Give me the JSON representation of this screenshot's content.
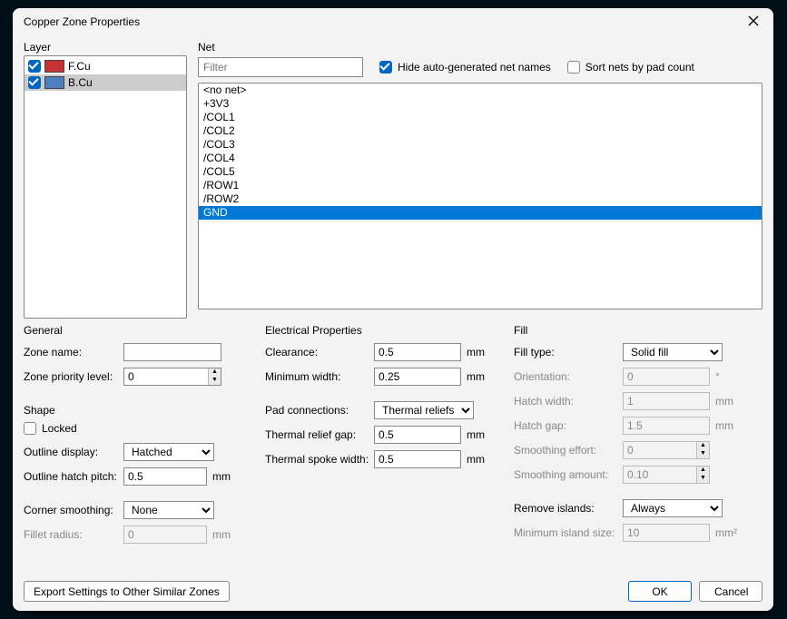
{
  "window": {
    "title": "Copper Zone Properties"
  },
  "layer": {
    "label": "Layer",
    "items": [
      {
        "name": "F.Cu",
        "color": "#c83232",
        "checked": true,
        "selected": false
      },
      {
        "name": "B.Cu",
        "color": "#4d7fc0",
        "checked": true,
        "selected": true
      }
    ]
  },
  "net": {
    "label": "Net",
    "filter_placeholder": "Filter",
    "hide_auto_label": "Hide auto-generated net names",
    "hide_auto_checked": true,
    "sort_pad_label": "Sort nets by pad count",
    "sort_pad_checked": false,
    "items": [
      {
        "name": "<no net>",
        "selected": false
      },
      {
        "name": "+3V3",
        "selected": false
      },
      {
        "name": "/COL1",
        "selected": false
      },
      {
        "name": "/COL2",
        "selected": false
      },
      {
        "name": "/COL3",
        "selected": false
      },
      {
        "name": "/COL4",
        "selected": false
      },
      {
        "name": "/COL5",
        "selected": false
      },
      {
        "name": "/ROW1",
        "selected": false
      },
      {
        "name": "/ROW2",
        "selected": false
      },
      {
        "name": "GND",
        "selected": true
      }
    ]
  },
  "general": {
    "title": "General",
    "zone_name_label": "Zone name:",
    "zone_name_value": "",
    "priority_label": "Zone priority level:",
    "priority_value": "0"
  },
  "shape": {
    "title": "Shape",
    "locked_label": "Locked",
    "locked_checked": false,
    "outline_display_label": "Outline display:",
    "outline_display_value": "Hatched",
    "hatch_pitch_label": "Outline hatch pitch:",
    "hatch_pitch_value": "0.5",
    "hatch_pitch_unit": "mm",
    "corner_smoothing_label": "Corner smoothing:",
    "corner_smoothing_value": "None",
    "fillet_radius_label": "Fillet radius:",
    "fillet_radius_value": "0",
    "fillet_radius_unit": "mm"
  },
  "electrical": {
    "title": "Electrical Properties",
    "clearance_label": "Clearance:",
    "clearance_value": "0.5",
    "clearance_unit": "mm",
    "min_width_label": "Minimum width:",
    "min_width_value": "0.25",
    "min_width_unit": "mm",
    "pad_conn_label": "Pad connections:",
    "pad_conn_value": "Thermal reliefs",
    "relief_gap_label": "Thermal relief gap:",
    "relief_gap_value": "0.5",
    "relief_gap_unit": "mm",
    "spoke_width_label": "Thermal spoke width:",
    "spoke_width_value": "0.5",
    "spoke_width_unit": "mm"
  },
  "fill": {
    "title": "Fill",
    "fill_type_label": "Fill type:",
    "fill_type_value": "Solid fill",
    "orientation_label": "Orientation:",
    "orientation_value": "0",
    "orientation_unit": "°",
    "hatch_width_label": "Hatch width:",
    "hatch_width_value": "1",
    "hatch_width_unit": "mm",
    "hatch_gap_label": "Hatch gap:",
    "hatch_gap_value": "1.5",
    "hatch_gap_unit": "mm",
    "smooth_effort_label": "Smoothing effort:",
    "smooth_effort_value": "0",
    "smooth_amount_label": "Smoothing amount:",
    "smooth_amount_value": "0.10",
    "remove_islands_label": "Remove islands:",
    "remove_islands_value": "Always",
    "min_island_label": "Minimum island size:",
    "min_island_value": "10",
    "min_island_unit": "mm²"
  },
  "footer": {
    "export_label": "Export Settings to Other Similar Zones",
    "ok_label": "OK",
    "cancel_label": "Cancel"
  }
}
